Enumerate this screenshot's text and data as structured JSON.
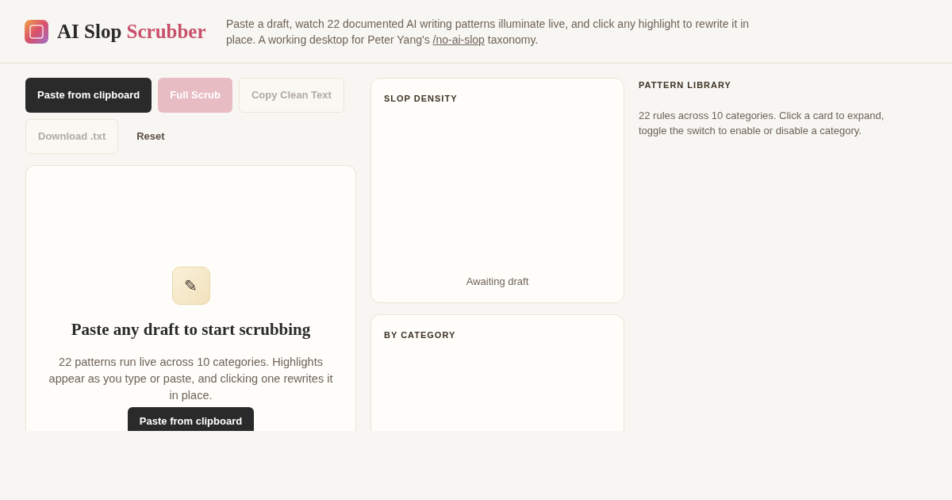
{
  "header": {
    "brand": {
      "first": "AI Slop",
      "second": "Scrubber"
    },
    "description": {
      "before": "Paste a draft, watch 22 documented AI writing patterns illuminate live, and click any highlight to rewrite it in place. A working desktop for Peter Yang's ",
      "link": "/no-ai-slop",
      "after": " taxonomy."
    }
  },
  "toolbar": [
    {
      "label": "Paste from clipboard",
      "kind": "primary",
      "disabled": false
    },
    {
      "label": "Full Scrub",
      "kind": "accent",
      "disabled": true
    },
    {
      "label": "Copy Clean Text",
      "kind": "outline",
      "disabled": true
    },
    {
      "label": "Download .txt",
      "kind": "outline",
      "disabled": true
    },
    {
      "label": "Reset",
      "kind": "ghost",
      "disabled": false
    }
  ],
  "editor": {
    "icon": "✎",
    "title": "Paste any draft to start scrubbing",
    "body": "22 patterns run live across 10 categories. Highlights appear as you type or paste, and clicking one rewrites it in place.",
    "button": "Paste from clipboard"
  },
  "slop_density": {
    "title": "SLOP DENSITY",
    "status": "Awaiting draft"
  },
  "by_category": {
    "title": "BY CATEGORY"
  },
  "pattern_library": {
    "title": "PATTERN LIBRARY",
    "description": "22 rules across 10 categories. Click a card to expand, toggle the switch to enable or disable a category."
  }
}
